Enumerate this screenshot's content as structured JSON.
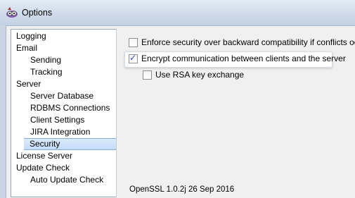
{
  "window": {
    "title": "Options"
  },
  "tree": {
    "items": [
      {
        "label": "Logging",
        "level": 0,
        "selected": false
      },
      {
        "label": "Email",
        "level": 0,
        "selected": false
      },
      {
        "label": "Sending",
        "level": 1,
        "selected": false
      },
      {
        "label": "Tracking",
        "level": 1,
        "selected": false
      },
      {
        "label": "Server",
        "level": 0,
        "selected": false
      },
      {
        "label": "Server Database",
        "level": 1,
        "selected": false
      },
      {
        "label": "RDBMS Connections",
        "level": 1,
        "selected": false
      },
      {
        "label": "Client Settings",
        "level": 1,
        "selected": false
      },
      {
        "label": "JIRA Integration",
        "level": 1,
        "selected": false
      },
      {
        "label": "Security",
        "level": 1,
        "selected": true
      },
      {
        "label": "License Server",
        "level": 0,
        "selected": false
      },
      {
        "label": "Update Check",
        "level": 0,
        "selected": false
      },
      {
        "label": "Auto Update Check",
        "level": 1,
        "selected": false
      }
    ]
  },
  "security": {
    "enforce": {
      "label": "Enforce security over backward compatibility if conflicts occur",
      "checked": false
    },
    "encrypt": {
      "label": "Encrypt communication between clients and the server",
      "checked": true
    },
    "rsa": {
      "label": "Use RSA key exchange",
      "checked": false
    },
    "openssl_version": "OpenSSL 1.0.2j  26 Sep 2016"
  },
  "icons": {
    "app": "app-logo-icon",
    "check": "checkmark-icon"
  }
}
